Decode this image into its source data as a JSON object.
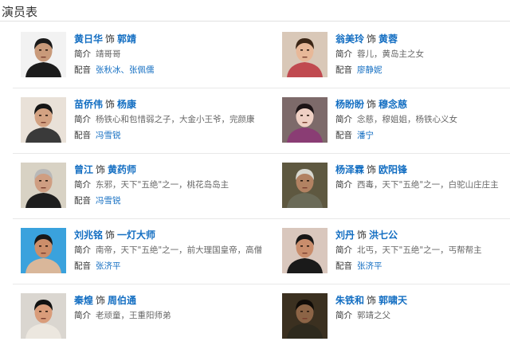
{
  "section": {
    "title": "演员表"
  },
  "labels": {
    "as": "饰",
    "intro": "简介",
    "voice": "配音"
  },
  "colors": {
    "link": "#136ec2",
    "text": "#333333",
    "muted": "#666666",
    "rule": "#e8e8e8"
  },
  "cast": [
    {
      "actor": "黄日华",
      "role": "郭靖",
      "intro": "靖哥哥",
      "voice": "张秋冰、张佩儒"
    },
    {
      "actor": "翁美玲",
      "role": "黄蓉",
      "intro": "蓉儿，黄岛主之女",
      "voice": "廖静妮"
    },
    {
      "actor": "苗侨伟",
      "role": "杨康",
      "intro": "杨铁心和包惜弱之子，大金小王爷，完颜康",
      "voice": "冯雪锐"
    },
    {
      "actor": "杨盼盼",
      "role": "穆念慈",
      "intro": "念慈，穆姐姐，杨铁心义女",
      "voice": "潘宁"
    },
    {
      "actor": "曾江",
      "role": "黄药师",
      "intro": "东邪，天下\"五绝\"之一，桃花岛岛主",
      "voice": "冯雪锐"
    },
    {
      "actor": "杨泽霖",
      "role": "欧阳锋",
      "intro": "西毒，天下\"五绝\"之一，白驼山庄庄主",
      "voice": ""
    },
    {
      "actor": "刘兆铭",
      "role": "一灯大师",
      "intro": "南帝，天下\"五绝\"之一，前大理国皇帝，高僧",
      "voice": "张济平"
    },
    {
      "actor": "刘丹",
      "role": "洪七公",
      "intro": "北丐，天下\"五绝\"之一，丐帮帮主",
      "voice": "张济平"
    },
    {
      "actor": "秦煌",
      "role": "周伯通",
      "intro": "老顽童，王重阳师弟",
      "voice": ""
    },
    {
      "actor": "朱铁和",
      "role": "郭啸天",
      "intro": "郭靖之父",
      "voice": ""
    }
  ]
}
